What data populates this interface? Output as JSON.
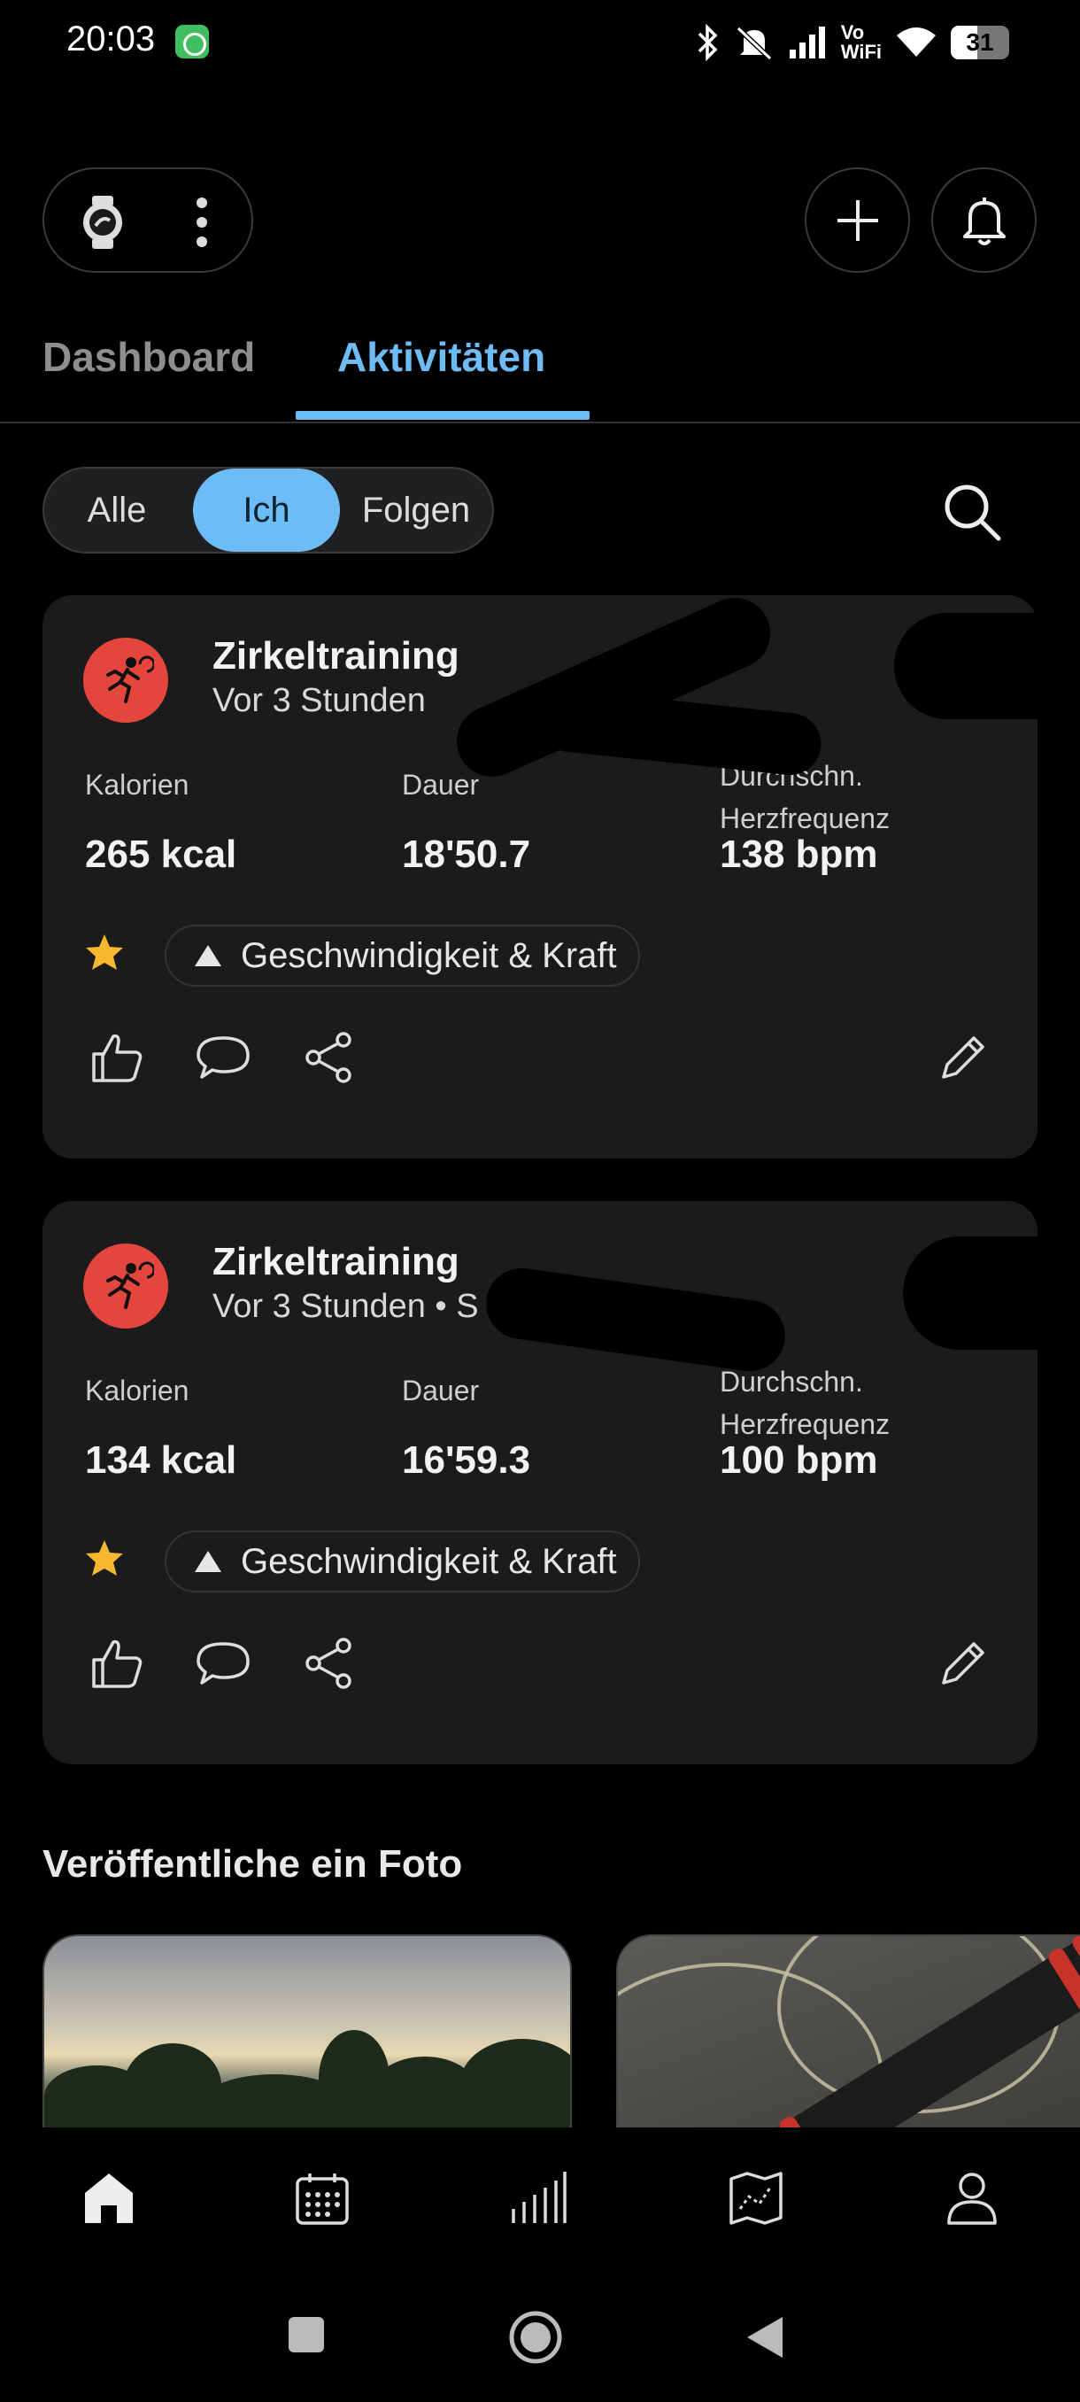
{
  "status_bar": {
    "time": "20:03",
    "volte_line1": "Vo",
    "volte_line2": "WiFi",
    "battery": "31"
  },
  "tabs": [
    {
      "label": "Dashboard"
    },
    {
      "label": "Aktivitäten"
    }
  ],
  "filter": {
    "options": [
      "Alle",
      "Ich",
      "Folgen"
    ],
    "selected": "Ich"
  },
  "activities": [
    {
      "title": "Zirkeltraining",
      "subtitle": "Vor 3 Stunden",
      "stats": [
        {
          "label": "Kalorien",
          "value": "265 kcal"
        },
        {
          "label": "Dauer",
          "value": "18'50.7"
        },
        {
          "label": "Durchschn. Herzfrequenz",
          "value": "138 bpm"
        }
      ],
      "tag": "Geschwindigkeit & Kraft"
    },
    {
      "title": "Zirkeltraining",
      "subtitle": "Vor 3 Stunden • S",
      "stats": [
        {
          "label": "Kalorien",
          "value": "134 kcal"
        },
        {
          "label": "Dauer",
          "value": "16'59.3"
        },
        {
          "label": "Durchschn. Herzfrequenz",
          "value": "100 bpm"
        }
      ],
      "tag": "Geschwindigkeit & Kraft"
    }
  ],
  "photo_section": {
    "title": "Veröffentliche ein Foto"
  },
  "colors": {
    "accent": "#6ebcf6",
    "activity_icon": "#e4463d",
    "star": "#f5b82e",
    "card_bg": "#1b1b1d"
  },
  "icons": {
    "top_bar": [
      "watch-icon",
      "more-vertical-icon",
      "plus-icon",
      "bell-icon"
    ],
    "bottom_nav": [
      "home-icon",
      "calendar-icon",
      "stats-icon",
      "map-icon",
      "profile-icon"
    ],
    "system_nav": [
      "recents-icon",
      "home-circle-icon",
      "back-icon"
    ]
  }
}
